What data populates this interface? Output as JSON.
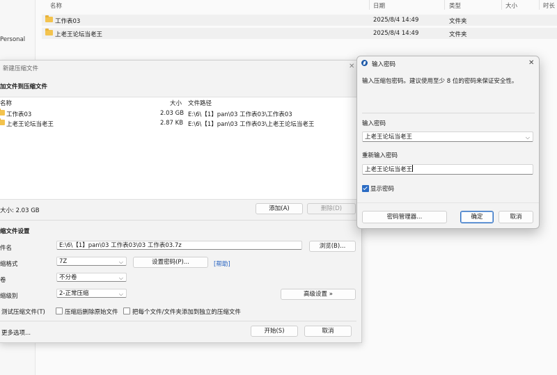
{
  "explorer": {
    "columns": {
      "name": "名称",
      "date": "日期",
      "type": "类型",
      "size": "大小",
      "time": "时长"
    },
    "nav_item": "Personal",
    "files": [
      {
        "name": "工作表03",
        "date": "2025/8/4 14:49",
        "type": "文件夹"
      },
      {
        "name": "上老王论坛当老王",
        "date": "2025/8/4 14:49",
        "type": "文件夹"
      }
    ]
  },
  "compress": {
    "title": "新建压缩文件",
    "section_add": "加文件到压缩文件",
    "list_headers": {
      "name": "名称",
      "size": "大小",
      "path": "文件路径"
    },
    "list_rows": [
      {
        "name": "工作表03",
        "size": "2.03 GB",
        "path": "E:\\6\\【1】pan\\03 工作表03\\工作表03"
      },
      {
        "name": "上老王论坛当老王",
        "size": "2.87 KB",
        "path": "E:\\6\\【1】pan\\03 工作表03\\上老王论坛当老王"
      }
    ],
    "total_size": "大小: 2.03 GB",
    "add_button": "添加(A)",
    "delete_button": "删除(D)",
    "section_settings": "缩文件设置",
    "filename_label": "件名",
    "filename_value": "E:\\6\\【1】pan\\03 工作表03\\03 工作表03.7z",
    "browse_button": "浏览(B)...",
    "format_label": "缩格式",
    "format_value": "7Z",
    "set_password_button": "设置密码(P)...",
    "help_link": "[帮助]",
    "volume_label": "卷",
    "volume_value": "不分卷",
    "level_label": "缩级别",
    "level_value": "2-正常压缩",
    "advanced_button": "高级设置 »",
    "test_label": "测试压缩文件(T)",
    "delete_after_label": "压缩后删除原始文件",
    "each_label": "把每个文件/文件夹添加到独立的压缩文件",
    "more_options": "更多选项...",
    "start_button": "开始(S)",
    "cancel_button": "取消"
  },
  "password": {
    "title": "输入密码",
    "close": "✕",
    "description": "输入压缩包密码。建议使用至少 8 位的密码来保证安全性。",
    "enter_label": "输入密码",
    "enter_value": "上老王论坛当老王",
    "reenter_label": "重新输入密码",
    "reenter_value": "上老王论坛当老王",
    "show_label": "显示密码",
    "show_checked": true,
    "manager_button": "密码管理器...",
    "ok_button": "确定",
    "cancel_button": "取消"
  }
}
